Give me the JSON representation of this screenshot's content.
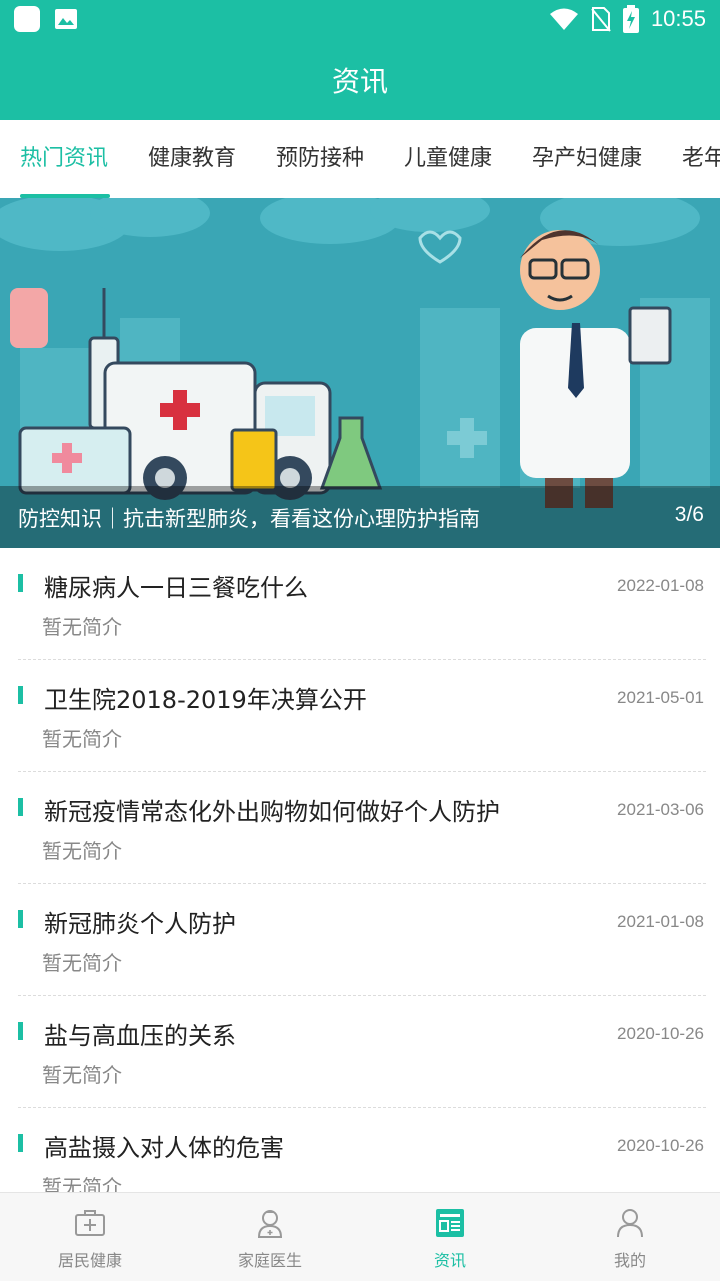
{
  "status_bar": {
    "time": "10:55",
    "left_icons": [
      "app-square-icon",
      "image-icon"
    ],
    "right_icons": [
      "wifi-icon",
      "no-sim-icon",
      "battery-charging-icon"
    ]
  },
  "header": {
    "title": "资讯"
  },
  "tabs": [
    {
      "label": "热门资讯",
      "active": true
    },
    {
      "label": "健康教育",
      "active": false
    },
    {
      "label": "预防接种",
      "active": false
    },
    {
      "label": "儿童健康",
      "active": false
    },
    {
      "label": "孕产妇健康",
      "active": false
    },
    {
      "label": "老年",
      "active": false
    }
  ],
  "banner": {
    "caption": "防控知识｜抗击新型肺炎，看看这份心理防护指南",
    "counter": "3/6"
  },
  "articles": [
    {
      "title": "糖尿病人一日三餐吃什么",
      "date": "2022-01-08",
      "desc": "暂无简介"
    },
    {
      "title": "卫生院2018-2019年决算公开",
      "date": "2021-05-01",
      "desc": "暂无简介"
    },
    {
      "title": "新冠疫情常态化外出购物如何做好个人防护",
      "date": "2021-03-06",
      "desc": "暂无简介"
    },
    {
      "title": "新冠肺炎个人防护",
      "date": "2021-01-08",
      "desc": "暂无简介"
    },
    {
      "title": "盐与高血压的关系",
      "date": "2020-10-26",
      "desc": "暂无简介"
    },
    {
      "title": "高盐摄入对人体的危害",
      "date": "2020-10-26",
      "desc": "暂无简介"
    }
  ],
  "bottom_nav": [
    {
      "label": "居民健康",
      "icon": "medical-kit-icon",
      "active": false
    },
    {
      "label": "家庭医生",
      "icon": "doctor-icon",
      "active": false
    },
    {
      "label": "资讯",
      "icon": "news-icon",
      "active": true
    },
    {
      "label": "我的",
      "icon": "person-icon",
      "active": false
    }
  ],
  "colors": {
    "accent": "#1cbfa4",
    "text": "#222222",
    "muted": "#888888"
  }
}
